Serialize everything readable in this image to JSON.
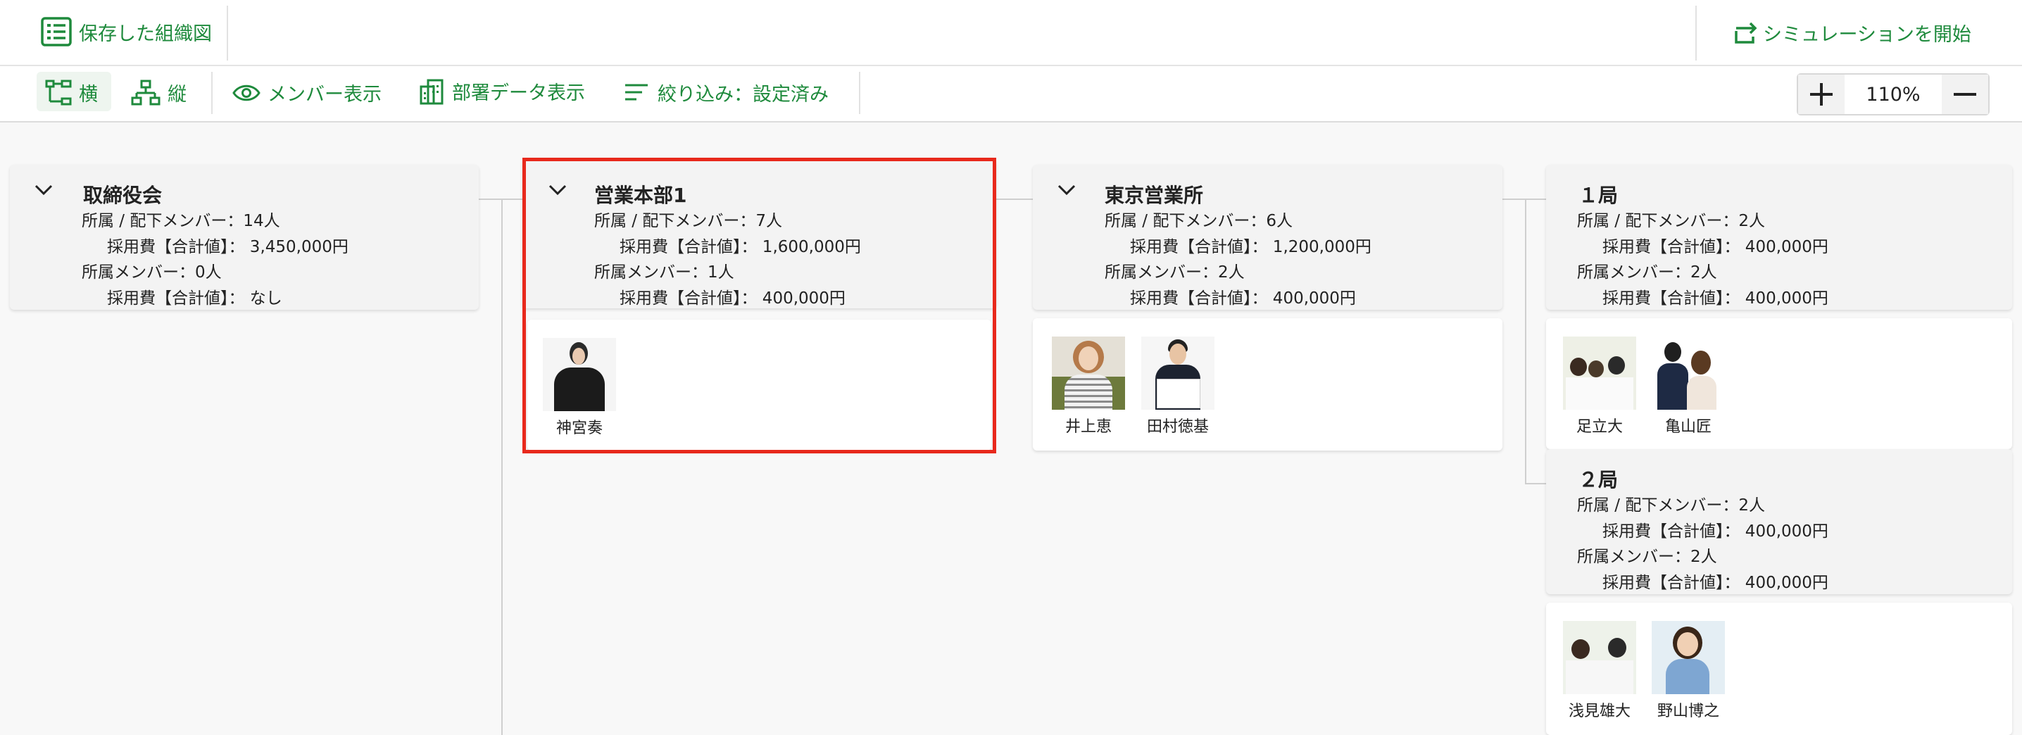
{
  "header": {
    "saved_charts_label": "保存した組織図",
    "simulation_label": "シミュレーションを開始"
  },
  "toolbar": {
    "horizontal_label": "横",
    "vertical_label": "縦",
    "member_view_label": "メンバー表示",
    "dept_data_label": "部署データ表示",
    "filter_label": "絞り込み：設定済み",
    "zoom_value": "110%"
  },
  "colors": {
    "accent": "#1e8a3c",
    "highlight": "#e8291c"
  },
  "icons": [
    "saved-list-icon",
    "simulation-icon",
    "horizontal-layout-icon",
    "vertical-layout-icon",
    "eye-icon",
    "building-icon",
    "filter-icon",
    "plus-icon",
    "minus-icon",
    "chevron-down-icon"
  ],
  "departments": [
    {
      "name": "取締役会",
      "line1": "所属 / 配下メンバー：14人",
      "line2": "採用費【合計値】： 3,450,000円",
      "line3": "所属メンバー：0人",
      "line4": "採用費【合計値】： なし",
      "members": []
    },
    {
      "name": "営業本部1",
      "line1": "所属 / 配下メンバー：7人",
      "line2": "採用費【合計値】： 1,600,000円",
      "line3": "所属メンバー：1人",
      "line4": "採用費【合計値】： 400,000円",
      "members": [
        "神宮奏"
      ]
    },
    {
      "name": "東京営業所",
      "line1": "所属 / 配下メンバー：6人",
      "line2": "採用費【合計値】： 1,200,000円",
      "line3": "所属メンバー：2人",
      "line4": "採用費【合計値】： 400,000円",
      "members": [
        "井上恵",
        "田村徳基"
      ]
    },
    {
      "name": "１局",
      "line1": "所属 / 配下メンバー：2人",
      "line2": "採用費【合計値】： 400,000円",
      "line3": "所属メンバー：2人",
      "line4": "採用費【合計値】： 400,000円",
      "members": [
        "足立大",
        "亀山匠"
      ]
    },
    {
      "name": "２局",
      "line1": "所属 / 配下メンバー：2人",
      "line2": "採用費【合計値】： 400,000円",
      "line3": "所属メンバー：2人",
      "line4": "採用費【合計値】： 400,000円",
      "members": [
        "浅見雄大",
        "野山博之"
      ]
    }
  ]
}
